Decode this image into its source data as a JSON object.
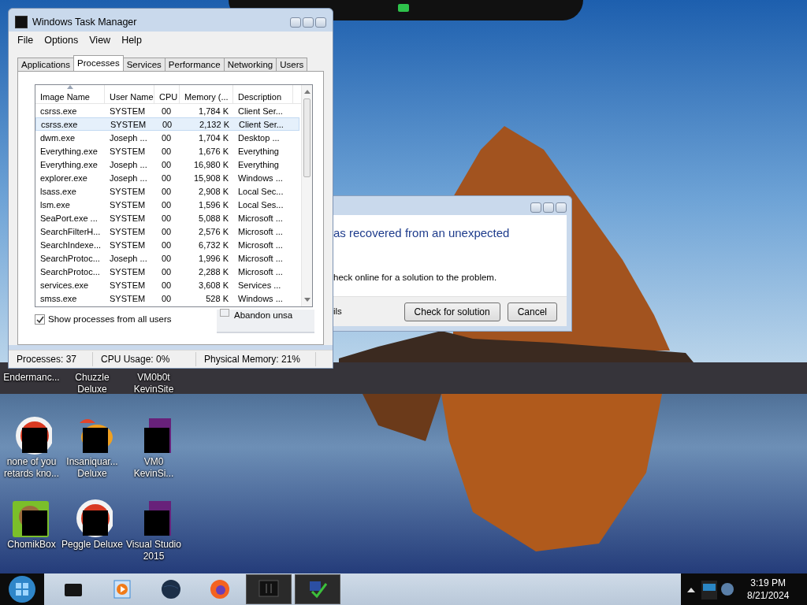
{
  "task_manager": {
    "title": "Windows Task Manager",
    "menu": [
      "File",
      "Options",
      "View",
      "Help"
    ],
    "tabs": [
      {
        "label": "Applications",
        "selected": false
      },
      {
        "label": "Processes",
        "selected": true
      },
      {
        "label": "Services",
        "selected": false
      },
      {
        "label": "Performance",
        "selected": false
      },
      {
        "label": "Networking",
        "selected": false
      },
      {
        "label": "Users",
        "selected": false
      }
    ],
    "columns": [
      {
        "label": "Image Name",
        "sorted": true
      },
      {
        "label": "User Name",
        "sorted": false
      },
      {
        "label": "CPU",
        "sorted": false
      },
      {
        "label": "Memory (...",
        "sorted": false
      },
      {
        "label": "Description",
        "sorted": false
      }
    ],
    "rows": [
      {
        "cells": [
          "csrss.exe",
          "SYSTEM",
          "00",
          "1,784 K",
          "Client Ser..."
        ],
        "selected": false
      },
      {
        "cells": [
          "csrss.exe",
          "SYSTEM",
          "00",
          "2,132 K",
          "Client Ser..."
        ],
        "selected": true
      },
      {
        "cells": [
          "dwm.exe",
          "Joseph ...",
          "00",
          "1,704 K",
          "Desktop ..."
        ],
        "selected": false
      },
      {
        "cells": [
          "Everything.exe",
          "SYSTEM",
          "00",
          "1,676 K",
          "Everything"
        ],
        "selected": false
      },
      {
        "cells": [
          "Everything.exe",
          "Joseph ...",
          "00",
          "16,980 K",
          "Everything"
        ],
        "selected": false
      },
      {
        "cells": [
          "explorer.exe",
          "Joseph ...",
          "00",
          "15,908 K",
          "Windows ..."
        ],
        "selected": false
      },
      {
        "cells": [
          "lsass.exe",
          "SYSTEM",
          "00",
          "2,908 K",
          "Local Sec..."
        ],
        "selected": false
      },
      {
        "cells": [
          "lsm.exe",
          "SYSTEM",
          "00",
          "1,596 K",
          "Local Ses..."
        ],
        "selected": false
      },
      {
        "cells": [
          "SeaPort.exe ...",
          "SYSTEM",
          "00",
          "5,088 K",
          "Microsoft ..."
        ],
        "selected": false
      },
      {
        "cells": [
          "SearchFilterH...",
          "SYSTEM",
          "00",
          "2,576 K",
          "Microsoft ..."
        ],
        "selected": false
      },
      {
        "cells": [
          "SearchIndexe...",
          "SYSTEM",
          "00",
          "6,732 K",
          "Microsoft ..."
        ],
        "selected": false
      },
      {
        "cells": [
          "SearchProtoc...",
          "Joseph ...",
          "00",
          "1,996 K",
          "Microsoft ..."
        ],
        "selected": false
      },
      {
        "cells": [
          "SearchProtoc...",
          "SYSTEM",
          "00",
          "2,288 K",
          "Microsoft ..."
        ],
        "selected": false
      },
      {
        "cells": [
          "services.exe",
          "SYSTEM",
          "00",
          "3,608 K",
          "Services ..."
        ],
        "selected": false
      },
      {
        "cells": [
          "smss.exe",
          "SYSTEM",
          "00",
          "528 K",
          "Windows ..."
        ],
        "selected": false
      }
    ],
    "show_all_users": {
      "label": "Show processes from all users",
      "checked": true
    },
    "status_bar": [
      "Processes: 37",
      "CPU Usage: 0%",
      "Physical Memory: 21%"
    ]
  },
  "overlay_fragment": {
    "text": "Abandon unsa"
  },
  "error_dialog": {
    "heading": "as recovered from an unexpected",
    "message": "heck online for a solution to the problem.",
    "details_link": "ils",
    "buttons": [
      "Check for solution",
      "Cancel"
    ]
  },
  "desktop_icons": [
    {
      "label": "Endermanc...",
      "kind": "hidden"
    },
    {
      "label": "Chuzzle\nDeluxe",
      "kind": "hidden"
    },
    {
      "label": "VM0b0t\nKevinSite",
      "kind": "hidden"
    },
    {
      "label": "none of you\nretards kno...",
      "kind": "round"
    },
    {
      "label": "Insaniquar...\nDeluxe",
      "kind": "fish"
    },
    {
      "label": "VM0\nKevinSi...",
      "kind": "square"
    },
    {
      "label": "ChomikBox",
      "kind": "tile"
    },
    {
      "label": "Peggle Deluxe",
      "kind": "round"
    },
    {
      "label": "Visual Studio\n2015",
      "kind": "square"
    }
  ],
  "taskbar": {
    "apps": [
      {
        "kind": "box",
        "active": false
      },
      {
        "kind": "player",
        "active": false
      },
      {
        "kind": "globe",
        "active": false
      },
      {
        "kind": "browser",
        "active": false
      },
      {
        "kind": "monitor",
        "active": true
      },
      {
        "kind": "check",
        "active": true
      }
    ],
    "time": "3:19 PM",
    "date": "8/21/2024"
  }
}
